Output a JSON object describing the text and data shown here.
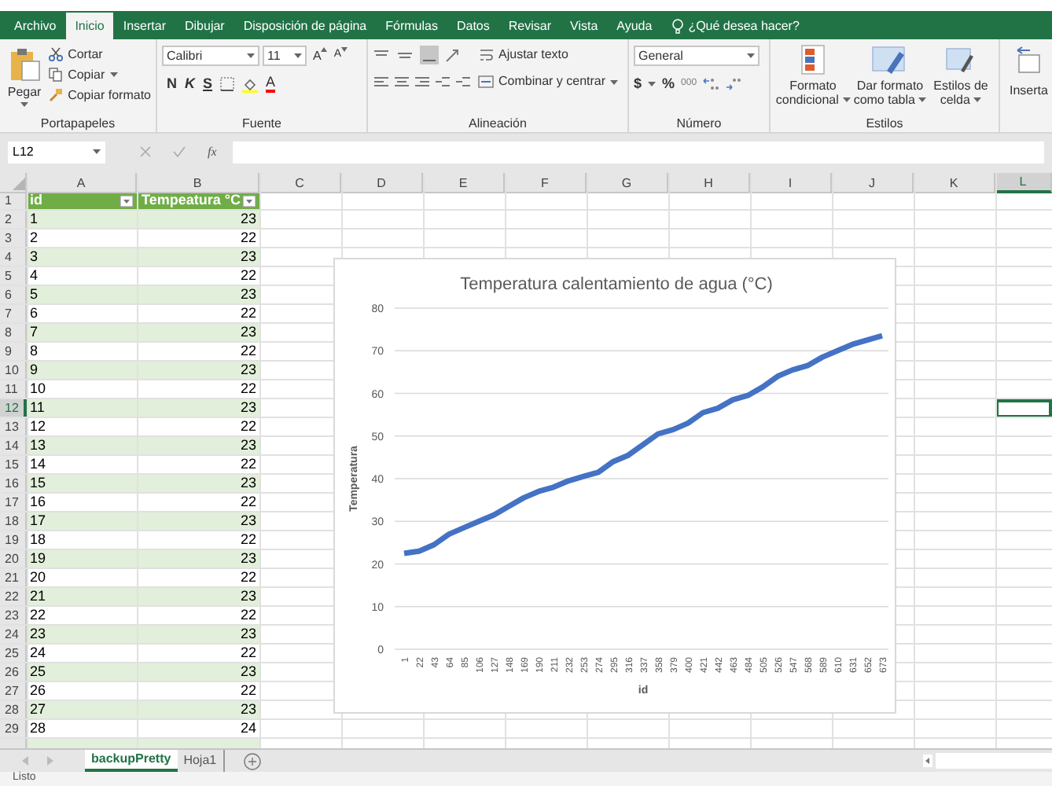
{
  "ribbon_tabs": [
    {
      "label": "Archivo",
      "selected": false
    },
    {
      "label": "Inicio",
      "selected": true
    },
    {
      "label": "Insertar",
      "selected": false
    },
    {
      "label": "Dibujar",
      "selected": false
    },
    {
      "label": "Disposición de página",
      "selected": false
    },
    {
      "label": "Fórmulas",
      "selected": false
    },
    {
      "label": "Datos",
      "selected": false
    },
    {
      "label": "Revisar",
      "selected": false
    },
    {
      "label": "Vista",
      "selected": false
    },
    {
      "label": "Ayuda",
      "selected": false
    }
  ],
  "tell_me": "¿Qué desea hacer?",
  "ribbon": {
    "clipboard": {
      "paste": "Pegar",
      "cut": "Cortar",
      "copy": "Copiar",
      "format_painter": "Copiar formato",
      "label": "Portapapeles"
    },
    "font": {
      "name": "Calibri",
      "size": "11",
      "grow": "A",
      "shrink": "A",
      "bold": "N",
      "italic": "K",
      "underline": "S",
      "font_color": "A",
      "label": "Fuente"
    },
    "alignment": {
      "wrap": "Ajustar texto",
      "merge": "Combinar y centrar",
      "label": "Alineación"
    },
    "number": {
      "format": "General",
      "currency": "$",
      "percent": "%",
      "thousands": "000",
      "label": "Número"
    },
    "styles": {
      "conditional": "Formato condicional",
      "as_table": "Dar formato como tabla",
      "cell_styles": "Estilos de celda",
      "label": "Estilos"
    },
    "insert": "Inserta"
  },
  "formula_bar": {
    "name_box": "L12",
    "fx": "fx"
  },
  "sheet": {
    "columns": [
      {
        "label": "A",
        "selected": false
      },
      {
        "label": "B",
        "selected": false
      },
      {
        "label": "C",
        "selected": false
      },
      {
        "label": "D",
        "selected": false
      },
      {
        "label": "E",
        "selected": false
      },
      {
        "label": "F",
        "selected": false
      },
      {
        "label": "G",
        "selected": false
      },
      {
        "label": "H",
        "selected": false
      },
      {
        "label": "I",
        "selected": false
      },
      {
        "label": "J",
        "selected": false
      },
      {
        "label": "K",
        "selected": false
      },
      {
        "label": "L",
        "selected": true
      }
    ],
    "header_row_number": "1",
    "table_columns": [
      "id",
      "Tempeatura °C"
    ],
    "rows": [
      {
        "row_number": "2",
        "id": "1",
        "value": "23",
        "selected": false
      },
      {
        "row_number": "3",
        "id": "2",
        "value": "22",
        "selected": false
      },
      {
        "row_number": "4",
        "id": "3",
        "value": "23",
        "selected": false
      },
      {
        "row_number": "5",
        "id": "4",
        "value": "22",
        "selected": false
      },
      {
        "row_number": "6",
        "id": "5",
        "value": "23",
        "selected": false
      },
      {
        "row_number": "7",
        "id": "6",
        "value": "22",
        "selected": false
      },
      {
        "row_number": "8",
        "id": "7",
        "value": "23",
        "selected": false
      },
      {
        "row_number": "9",
        "id": "8",
        "value": "22",
        "selected": false
      },
      {
        "row_number": "10",
        "id": "9",
        "value": "23",
        "selected": false
      },
      {
        "row_number": "11",
        "id": "10",
        "value": "22",
        "selected": false
      },
      {
        "row_number": "12",
        "id": "11",
        "value": "23",
        "selected": true
      },
      {
        "row_number": "13",
        "id": "12",
        "value": "22",
        "selected": false
      },
      {
        "row_number": "14",
        "id": "13",
        "value": "23",
        "selected": false
      },
      {
        "row_number": "15",
        "id": "14",
        "value": "22",
        "selected": false
      },
      {
        "row_number": "16",
        "id": "15",
        "value": "23",
        "selected": false
      },
      {
        "row_number": "17",
        "id": "16",
        "value": "22",
        "selected": false
      },
      {
        "row_number": "18",
        "id": "17",
        "value": "23",
        "selected": false
      },
      {
        "row_number": "19",
        "id": "18",
        "value": "22",
        "selected": false
      },
      {
        "row_number": "20",
        "id": "19",
        "value": "23",
        "selected": false
      },
      {
        "row_number": "21",
        "id": "20",
        "value": "22",
        "selected": false
      },
      {
        "row_number": "22",
        "id": "21",
        "value": "23",
        "selected": false
      },
      {
        "row_number": "23",
        "id": "22",
        "value": "22",
        "selected": false
      },
      {
        "row_number": "24",
        "id": "23",
        "value": "23",
        "selected": false
      },
      {
        "row_number": "25",
        "id": "24",
        "value": "22",
        "selected": false
      },
      {
        "row_number": "26",
        "id": "25",
        "value": "23",
        "selected": false
      },
      {
        "row_number": "27",
        "id": "26",
        "value": "22",
        "selected": false
      },
      {
        "row_number": "28",
        "id": "27",
        "value": "23",
        "selected": false
      },
      {
        "row_number": "29",
        "id": "28",
        "value": "24",
        "selected": false
      }
    ]
  },
  "chart": {
    "chart_data": {
      "type": "line",
      "title": "Temperatura calentamiento de agua (°C)",
      "xlabel": "id",
      "ylabel": "Temperatura",
      "categories": [
        "1",
        "22",
        "43",
        "64",
        "85",
        "106",
        "127",
        "148",
        "169",
        "190",
        "211",
        "232",
        "253",
        "274",
        "295",
        "316",
        "337",
        "358",
        "379",
        "400",
        "421",
        "442",
        "463",
        "484",
        "505",
        "526",
        "547",
        "568",
        "589",
        "610",
        "631",
        "652",
        "673"
      ],
      "series": [
        {
          "color": "#4472c4",
          "values": [
            22.5,
            23,
            24.5,
            27,
            28.5,
            30,
            31.5,
            33.5,
            35.5,
            37,
            38,
            39.5,
            40.5,
            41.5,
            44,
            45.5,
            48,
            50.5,
            51.5,
            53,
            55.5,
            56.5,
            58.5,
            59.5,
            61.5,
            64,
            65.5,
            66.5,
            68.5,
            70,
            71.5,
            72.5,
            73.5
          ]
        }
      ],
      "ylim": [
        0,
        80
      ],
      "grid": true,
      "yticks": [
        0,
        10,
        20,
        30,
        40,
        50,
        60,
        70,
        80
      ]
    }
  },
  "sheet_tabs": [
    {
      "label": "backupPretty",
      "selected": true
    },
    {
      "label": "Hoja1",
      "selected": false
    }
  ],
  "status": "Listo"
}
